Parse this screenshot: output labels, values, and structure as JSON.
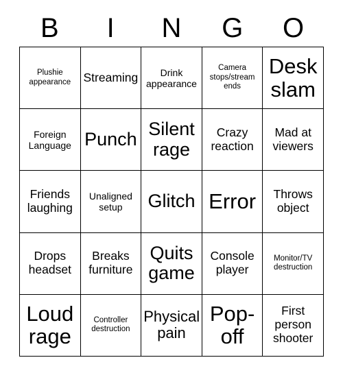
{
  "card": {
    "header_letters": [
      "B",
      "I",
      "N",
      "G",
      "O"
    ],
    "colors": {
      "background": "#ffffff",
      "text": "#000000",
      "grid_line": "#000000"
    },
    "grid": {
      "columns": 5,
      "rows": 5,
      "cells": [
        {
          "text": "Plushie appearance",
          "size": "xs"
        },
        {
          "text": "Streaming",
          "size": "md"
        },
        {
          "text": "Drink appearance",
          "size": "sm"
        },
        {
          "text": "Camera stops/stream ends",
          "size": "xs"
        },
        {
          "text": "Desk slam",
          "size": "xxl"
        },
        {
          "text": "Foreign Language",
          "size": "sm"
        },
        {
          "text": "Punch",
          "size": "xl"
        },
        {
          "text": "Silent rage",
          "size": "xl"
        },
        {
          "text": "Crazy reaction",
          "size": "md"
        },
        {
          "text": "Mad at viewers",
          "size": "md"
        },
        {
          "text": "Friends laughing",
          "size": "md"
        },
        {
          "text": "Unaligned setup",
          "size": "sm"
        },
        {
          "text": "Glitch",
          "size": "xl"
        },
        {
          "text": "Error",
          "size": "xxl"
        },
        {
          "text": "Throws object",
          "size": "md"
        },
        {
          "text": "Drops headset",
          "size": "md"
        },
        {
          "text": "Breaks furniture",
          "size": "md"
        },
        {
          "text": "Quits game",
          "size": "xl"
        },
        {
          "text": "Console player",
          "size": "md"
        },
        {
          "text": "Monitor/TV destruction",
          "size": "xs"
        },
        {
          "text": "Loud rage",
          "size": "xxl"
        },
        {
          "text": "Controller destruction",
          "size": "xs"
        },
        {
          "text": "Physical pain",
          "size": "lg"
        },
        {
          "text": "Pop-off",
          "size": "xxl"
        },
        {
          "text": "First person shooter",
          "size": "md"
        }
      ]
    }
  }
}
